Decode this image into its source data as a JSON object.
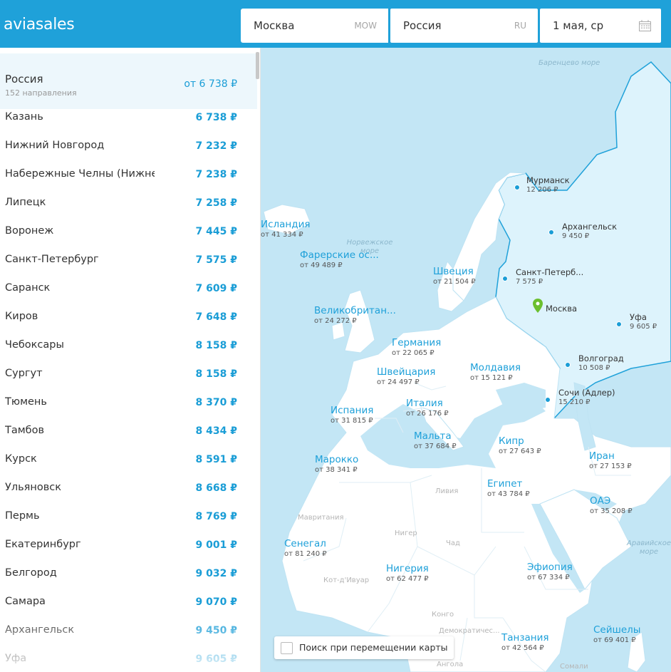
{
  "header": {
    "logo": "aviasales",
    "origin": {
      "city": "Москва",
      "code": "MOW"
    },
    "destination": {
      "city": "Россия",
      "code": "RU"
    },
    "date": "1 мая, ср"
  },
  "sidebar": {
    "title": "Россия",
    "subtitle": "152 направления",
    "price": "от 6 738 ₽",
    "items": [
      {
        "city": "Казань",
        "price": "6 738 ₽"
      },
      {
        "city": "Нижний Новгород",
        "price": "7 232 ₽"
      },
      {
        "city": "Набережные Челны (Нижнекамск)",
        "price": "7 238 ₽"
      },
      {
        "city": "Липецк",
        "price": "7 258 ₽"
      },
      {
        "city": "Воронеж",
        "price": "7 445 ₽"
      },
      {
        "city": "Санкт-Петербург",
        "price": "7 575 ₽"
      },
      {
        "city": "Саранск",
        "price": "7 609 ₽"
      },
      {
        "city": "Киров",
        "price": "7 648 ₽"
      },
      {
        "city": "Чебоксары",
        "price": "8 158 ₽"
      },
      {
        "city": "Сургут",
        "price": "8 158 ₽"
      },
      {
        "city": "Тюмень",
        "price": "8 370 ₽"
      },
      {
        "city": "Тамбов",
        "price": "8 434 ₽"
      },
      {
        "city": "Курск",
        "price": "8 591 ₽"
      },
      {
        "city": "Ульяновск",
        "price": "8 668 ₽"
      },
      {
        "city": "Пермь",
        "price": "8 769 ₽"
      },
      {
        "city": "Екатеринбург",
        "price": "9 001 ₽"
      },
      {
        "city": "Белгород",
        "price": "9 032 ₽"
      },
      {
        "city": "Самара",
        "price": "9 070 ₽"
      },
      {
        "city": "Архангельск",
        "price": "9 450 ₽"
      },
      {
        "city": "Уфа",
        "price": "9 605 ₽"
      }
    ]
  },
  "map": {
    "countries": [
      {
        "name": "Исландия",
        "price": "от 41 334 ₽"
      },
      {
        "name": "Фарерские ос...",
        "price": "от 49 489 ₽"
      },
      {
        "name": "Швеция",
        "price": "от 21 504 ₽"
      },
      {
        "name": "Великобритан...",
        "price": "от 24 272 ₽"
      },
      {
        "name": "Германия",
        "price": "от 22 065 ₽"
      },
      {
        "name": "Швейцария",
        "price": "от 24 497 ₽"
      },
      {
        "name": "Молдавия",
        "price": "от 15 121 ₽"
      },
      {
        "name": "Италия",
        "price": "от 26 176 ₽"
      },
      {
        "name": "Испания",
        "price": "от 31 815 ₽"
      },
      {
        "name": "Мальта",
        "price": "от 37 684 ₽"
      },
      {
        "name": "Кипр",
        "price": "от 27 643 ₽"
      },
      {
        "name": "Марокко",
        "price": "от 38 341 ₽"
      },
      {
        "name": "Иран",
        "price": "от 27 153 ₽"
      },
      {
        "name": "Египет",
        "price": "от 43 784 ₽"
      },
      {
        "name": "ОАЭ",
        "price": "от 35 208 ₽"
      },
      {
        "name": "Сенегал",
        "price": "от 81 240 ₽"
      },
      {
        "name": "Нигерия",
        "price": "от 62 477 ₽"
      },
      {
        "name": "Эфиопия",
        "price": "от 67 334 ₽"
      },
      {
        "name": "Сейшелы",
        "price": "от 69 401 ₽"
      },
      {
        "name": "Танзания",
        "price": "от 42 564 ₽"
      }
    ],
    "cities": [
      {
        "name": "Мурманск",
        "price": "12 206 ₽"
      },
      {
        "name": "Архангельск",
        "price": "9 450 ₽"
      },
      {
        "name": "Санкт-Петерб...",
        "price": "7 575 ₽"
      },
      {
        "name": "Москва",
        "price": ""
      },
      {
        "name": "Уфа",
        "price": "9 605 ₽"
      },
      {
        "name": "Волгоград",
        "price": "10 508 ₽"
      },
      {
        "name": "Сочи (Адлер)",
        "price": "15 210 ₽"
      }
    ],
    "seas": [
      "Баренцево море",
      "Норвежское море",
      "Аравийское море"
    ],
    "regions": [
      "Ливия",
      "Мавритания",
      "Нигер",
      "Чад",
      "Кот-д'Ивуар",
      "Конго",
      "Демократичес...",
      "Ангола",
      "Сомали"
    ],
    "origin_marker_color": "#6bbf2e",
    "dot_color": "#1a9dd6",
    "checkbox_label": "Поиск при перемещении карты",
    "checkbox_checked": false
  }
}
